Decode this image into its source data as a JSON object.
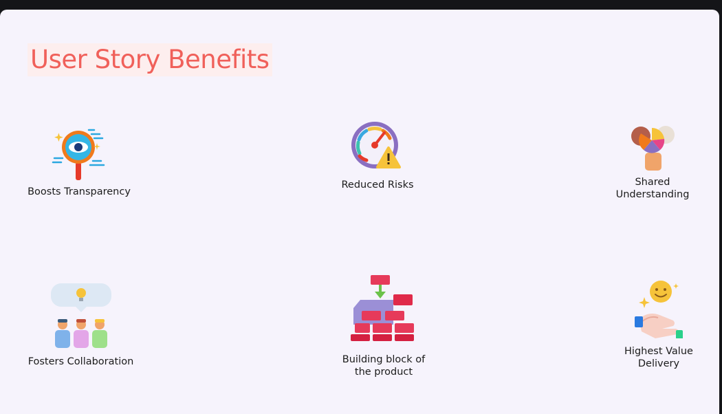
{
  "slide": {
    "title": "User Story Benefits"
  },
  "benefits": [
    {
      "label": "Boosts Transparency",
      "icon": "eye-magnifier-icon"
    },
    {
      "label": "Reduced Risks",
      "icon": "gauge-warning-icon"
    },
    {
      "label": "Shared\nUnderstanding",
      "icon": "hand-puzzle-icon"
    },
    {
      "label": "Fosters Collaboration",
      "icon": "team-idea-icon"
    },
    {
      "label": "Building block of\nthe product",
      "icon": "brick-wall-icon"
    },
    {
      "label": "Highest Value\nDelivery",
      "icon": "hand-smile-icon"
    }
  ],
  "colors": {
    "title": "#f0605a",
    "title_highlight": "#fdeeee",
    "slide_background": "#f6f3fc",
    "frame": "#141518"
  }
}
